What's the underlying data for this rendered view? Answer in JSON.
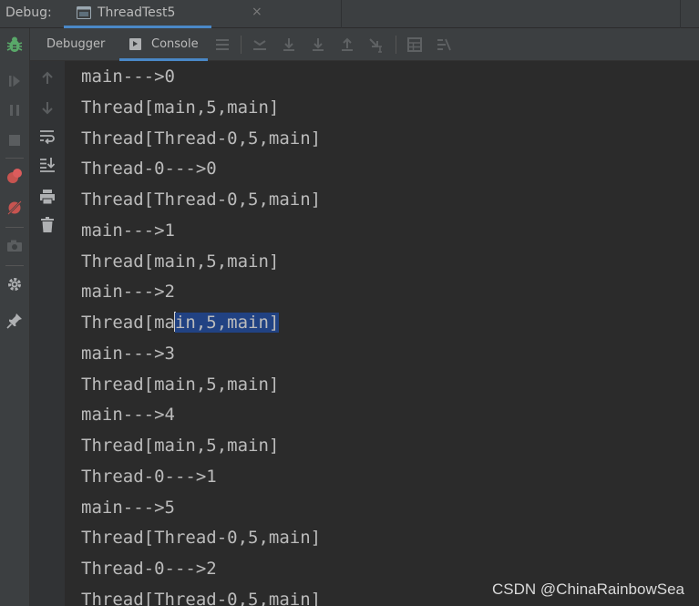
{
  "top_bar": {
    "debug_label": "Debug:",
    "tab": {
      "label": "ThreadTest5",
      "close": "×",
      "icon": "run-config-icon"
    }
  },
  "left_toolbar": {
    "buttons": [
      "debug-bug-icon",
      "resume-icon",
      "pause-icon",
      "stop-icon",
      "view-breakpoints-icon",
      "mute-breakpoints-icon",
      "snapshot-icon",
      "settings-icon",
      "pin-icon"
    ]
  },
  "sub_toolbar": {
    "tabs": [
      {
        "label": "Debugger",
        "active": false
      },
      {
        "label": "Console",
        "active": true,
        "icon": "console-icon"
      }
    ],
    "buttons": [
      "menu-icon",
      "show-execution-point-icon",
      "step-over-icon",
      "step-into-icon",
      "force-step-into-icon",
      "step-out-icon",
      "run-to-cursor-icon",
      "evaluate-expression-icon",
      "trace-icon"
    ]
  },
  "gutter_toolbar": {
    "buttons": [
      "up-arrow-icon",
      "down-arrow-icon",
      "soft-wrap-icon",
      "scroll-to-end-icon",
      "print-icon",
      "trash-icon"
    ]
  },
  "console": {
    "lines": [
      "main--->0",
      "Thread[main,5,main]",
      "Thread[Thread-0,5,main]",
      "Thread-0--->0",
      "Thread[Thread-0,5,main]",
      "main--->1",
      "Thread[main,5,main]",
      "main--->2",
      "Thread[main,5,main]",
      "main--->3",
      "Thread[main,5,main]",
      "main--->4",
      "Thread[main,5,main]",
      "Thread-0--->1",
      "main--->5",
      "Thread[Thread-0,5,main]",
      "Thread-0--->2",
      "Thread[Thread-0,5,main]"
    ],
    "selected_line": {
      "before": "Thread[ma",
      "selected": "in,5,main]"
    }
  },
  "watermark": "CSDN @ChinaRainbowSea",
  "colors": {
    "background": "#2b2b2b",
    "toolbar": "#3c3f41",
    "text": "#bbbbbb",
    "selection": "#214283",
    "accent": "#4a88c7",
    "bug_green": "#59a869",
    "breakpoint_red": "#c75450"
  }
}
